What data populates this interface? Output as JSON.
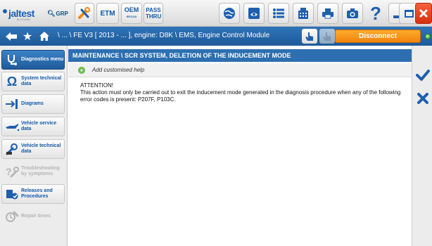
{
  "app": {
    "logo_text": "jaltest",
    "logo_sub": "by COJALI"
  },
  "toolbar": {
    "grp_label": "GRP",
    "etm_label": "ETM",
    "oem_label": "OEM",
    "oem_sub": "RP1210",
    "passthru_label": "PASS THRU"
  },
  "nav": {
    "breadcrumb": "\\ ... \\ FE V3 [ 2013 - ... ], engine: D8K \\ EMS, Engine Control Module",
    "disconnect_label": "Disconnect",
    "status_color": "#3aa52a"
  },
  "sidebar": {
    "items": [
      {
        "label": "Diagnostics menu",
        "icon": "stethoscope-icon",
        "active": true
      },
      {
        "label": "System technical data",
        "icon": "ohm-icon"
      },
      {
        "label": "Diagrams",
        "icon": "diagram-icon"
      },
      {
        "label": "Vehicle service data",
        "icon": "oil-can-icon"
      },
      {
        "label": "Vehicle technical data",
        "icon": "wrench-car-icon"
      },
      {
        "label": "Troubleshooting by symptoms",
        "icon": "troubleshooting-icon",
        "disabled": true
      },
      {
        "label": "Releases and Procedures",
        "icon": "procedures-icon"
      },
      {
        "label": "Repair times",
        "icon": "repair-times-icon",
        "disabled": true
      }
    ]
  },
  "main": {
    "title": "MAINTENANCE \\ SCR SYSTEM, DELETION OF THE INDUCEMENT MODE",
    "add_help_label": "Add customised help",
    "attention_label": "ATTENTION!",
    "message": "This action must only be carried out to exit the inducement mode generated in the diagnosis procedure when any of the following error codes is present: P207F, P103C."
  },
  "colors": {
    "accent_blue": "#2d6fb0",
    "disconnect_orange": "#f0830a",
    "confirm_blue": "#1e5fb0"
  }
}
